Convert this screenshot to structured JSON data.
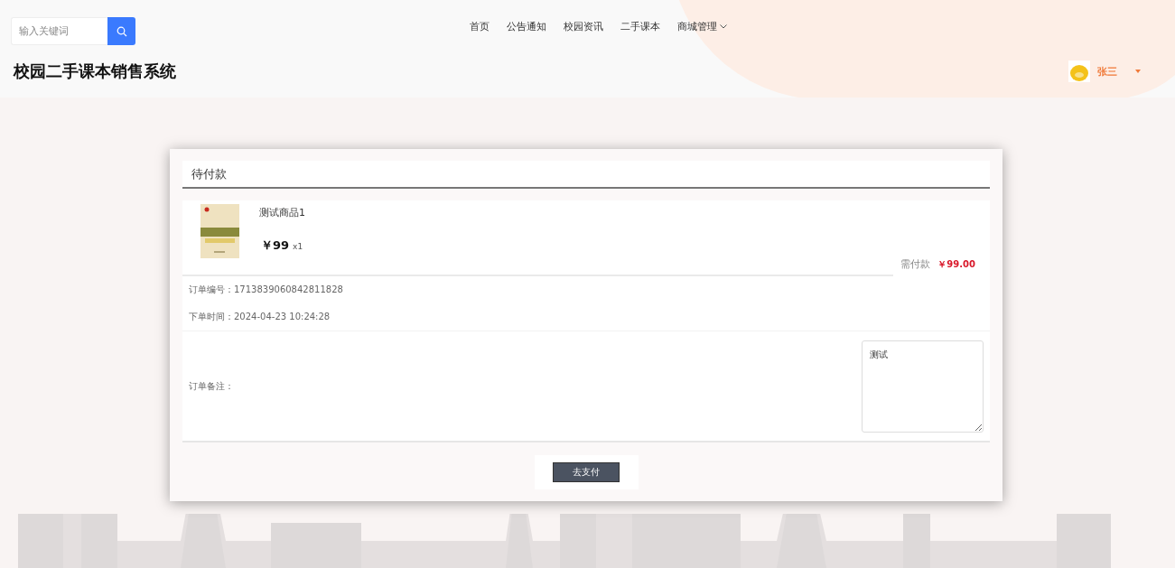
{
  "search": {
    "placeholder": "输入关键词"
  },
  "site_title": "校园二手课本销售系统",
  "nav": [
    {
      "label": "首页",
      "dropdown": false
    },
    {
      "label": "公告通知",
      "dropdown": false
    },
    {
      "label": "校园资讯",
      "dropdown": false
    },
    {
      "label": "二手课本",
      "dropdown": false
    },
    {
      "label": "商城管理",
      "dropdown": true
    }
  ],
  "user": {
    "name": "张三"
  },
  "order": {
    "status": "待付款",
    "item": {
      "name": "测试商品1",
      "price": "￥99",
      "quantity": "x1"
    },
    "total_label": "需付款",
    "total": "￥99.00",
    "number_label": "订单编号：",
    "number": "1713839060842811828",
    "time_label": "下单时间：",
    "time": "2024-04-23 10:24:28",
    "note_label": "订单备注：",
    "note": "测试",
    "pay_button": "去支付"
  }
}
